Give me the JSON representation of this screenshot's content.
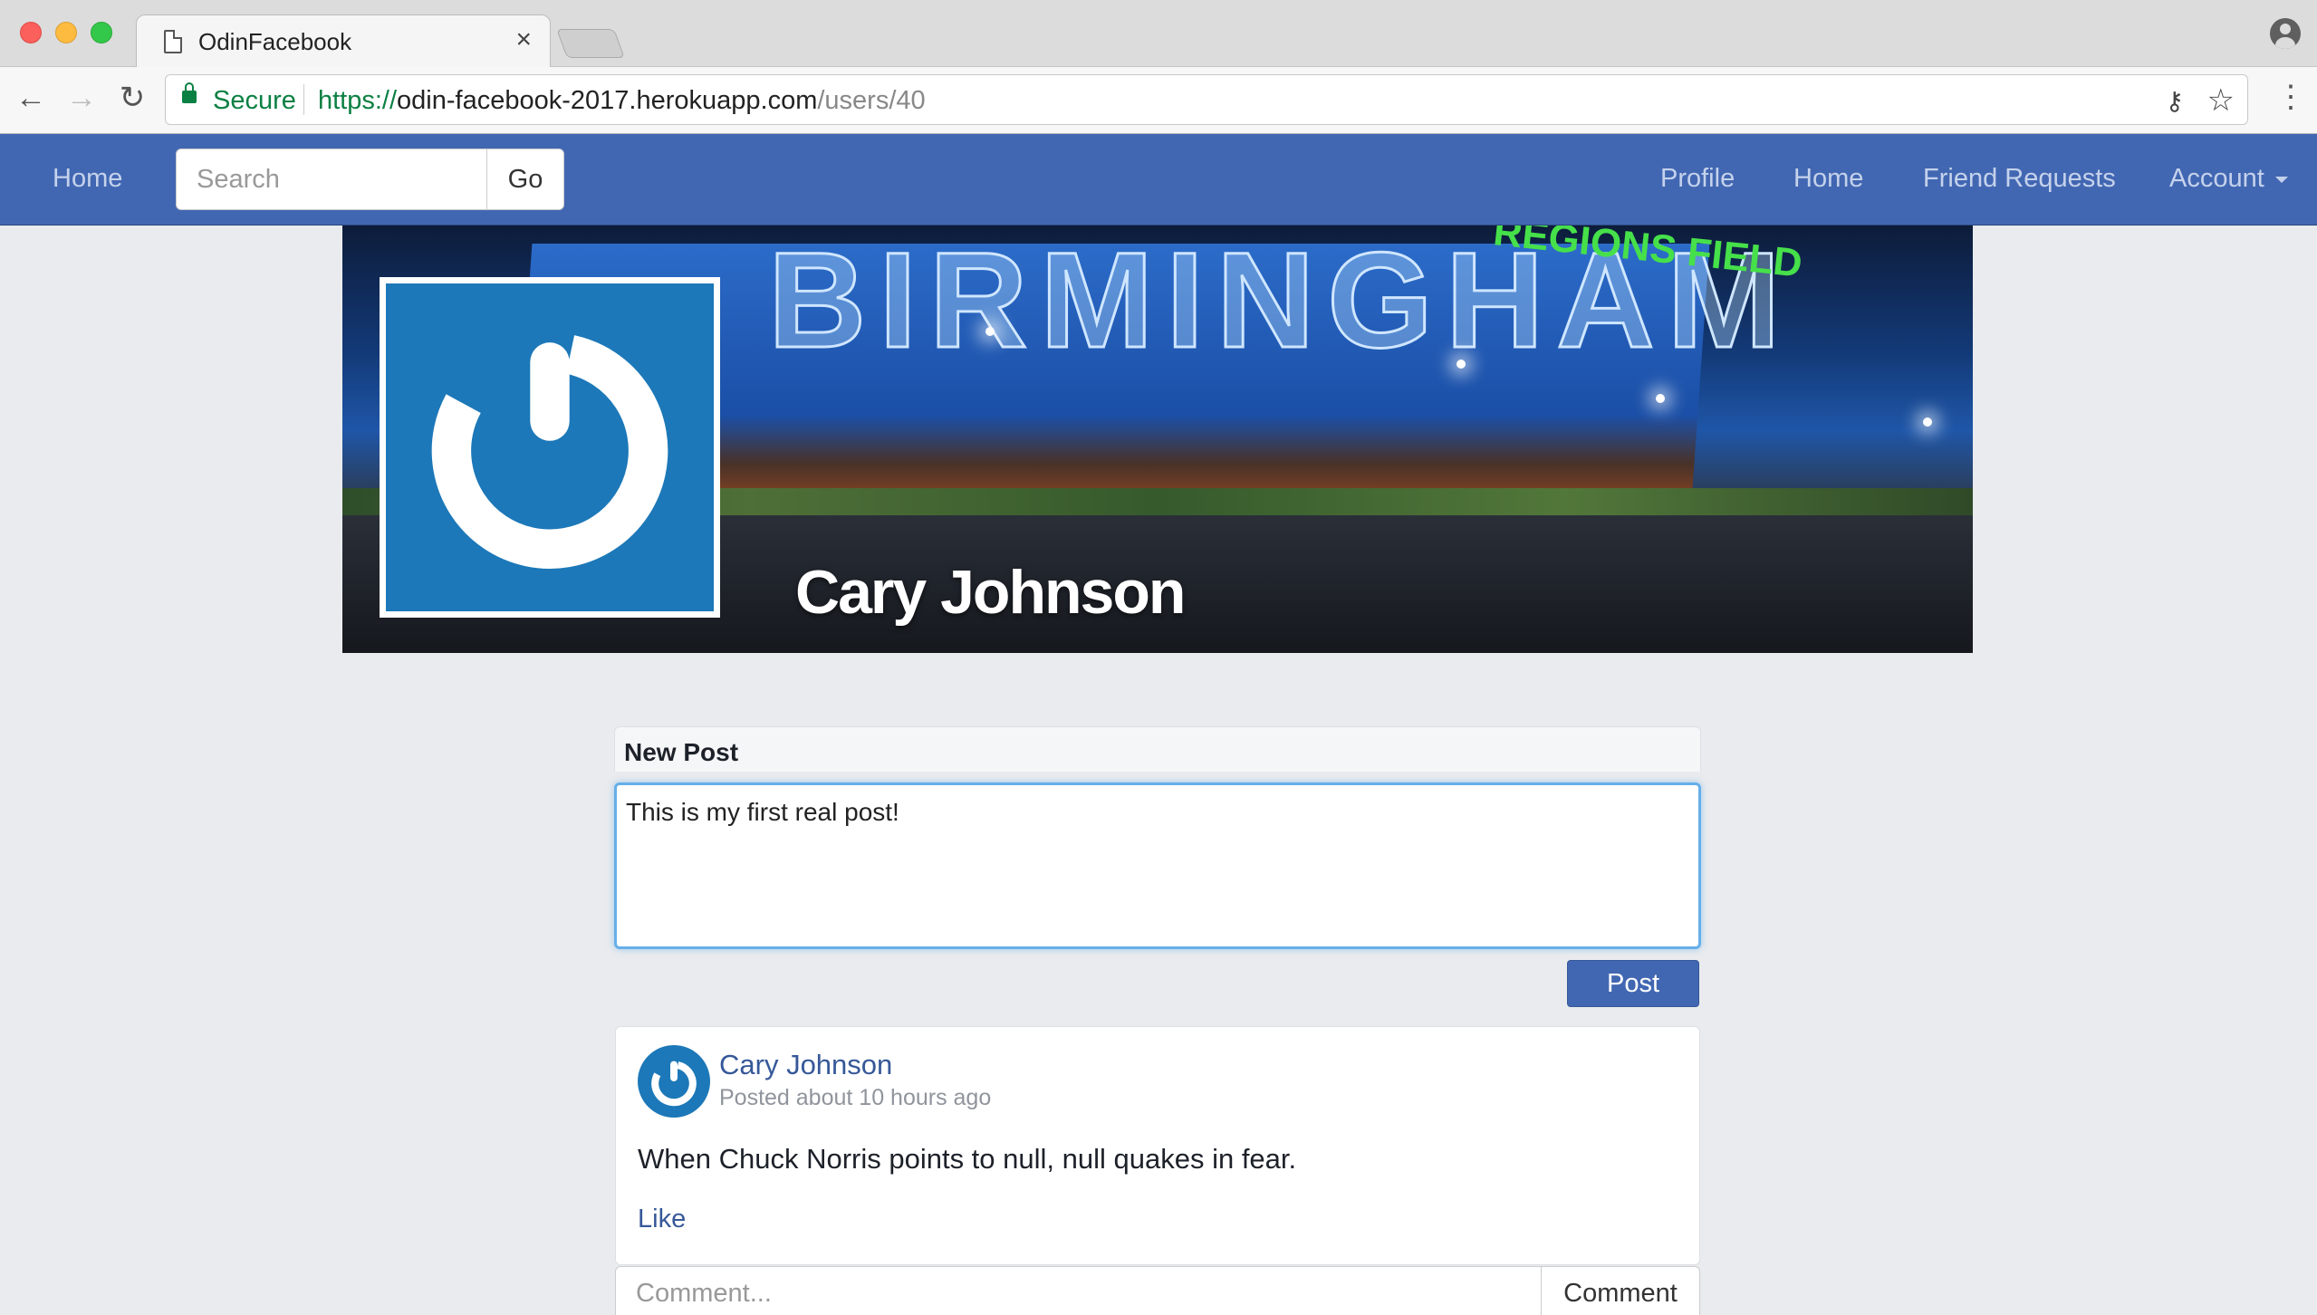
{
  "browser": {
    "tab_title": "OdinFacebook",
    "tab_close": "×",
    "secure_label": "Secure",
    "url_scheme": "https://",
    "url_host": "odin-facebook-2017.herokuapp.com",
    "url_path": "/users/40"
  },
  "navbar": {
    "home_left": "Home",
    "search_placeholder": "Search",
    "go_label": "Go",
    "profile": "Profile",
    "home": "Home",
    "friend_requests": "Friend Requests",
    "account": "Account"
  },
  "profile": {
    "name": "Cary Johnson",
    "cover_sign": "BIRMINGHAM",
    "cover_regions": "REGIONS FIELD"
  },
  "new_post": {
    "title": "New Post",
    "text": "This is my first real post!",
    "submit_label": "Post"
  },
  "post": {
    "author": "Cary Johnson",
    "time": "Posted about 10 hours ago",
    "body": "When Chuck Norris points to null, null quakes in fear.",
    "like_label": "Like",
    "comment_placeholder": "Comment...",
    "comment_button": "Comment"
  },
  "colors": {
    "brand": "#4267b2",
    "link": "#365899",
    "avatar_blue": "#1c78b8",
    "background": "#e9ebee"
  }
}
